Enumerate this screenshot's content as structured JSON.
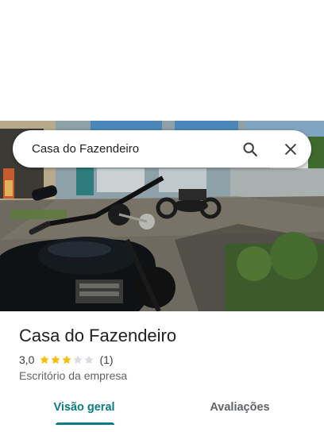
{
  "search": {
    "query": "Casa do Fazendeiro",
    "search_icon": "search-icon",
    "close_icon": "close-icon"
  },
  "photo": {
    "alt": "street-photo"
  },
  "place": {
    "name": "Casa do Fazendeiro",
    "rating": "3,0",
    "rating_stars": 3,
    "rating_max": 5,
    "review_count": "(1)",
    "category": "Escritório da empresa",
    "star_color": "#fbbc04",
    "star_empty_color": "#dadce0"
  },
  "tabs": [
    {
      "label": "Visão geral",
      "selected": true
    },
    {
      "label": "Avaliações",
      "selected": false
    }
  ],
  "colors": {
    "accent": "#0b7a82"
  }
}
